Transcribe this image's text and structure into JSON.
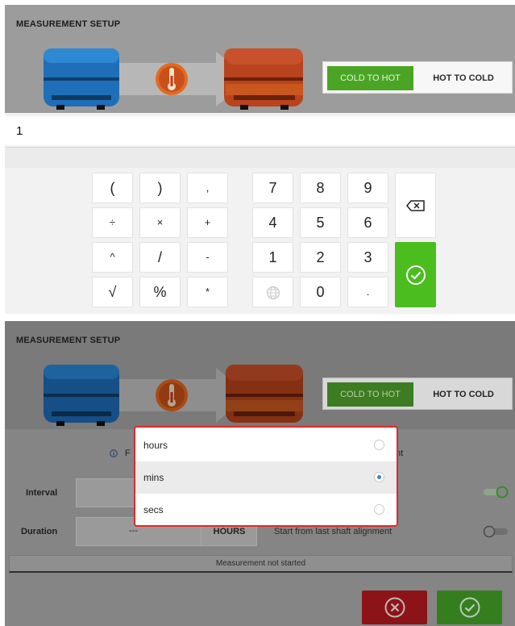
{
  "top": {
    "title": "MEASUREMENT SETUP",
    "direction": {
      "cold_to_hot": "COLD TO HOT",
      "hot_to_cold": "HOT TO COLD",
      "active": "cold_to_hot"
    },
    "input_value": "1",
    "keys": [
      "(",
      ")",
      ",",
      "7",
      "8",
      "9",
      "÷",
      "×",
      "+",
      "4",
      "5",
      "6",
      "^",
      "/",
      "-",
      "1",
      "2",
      "3",
      "√",
      "%",
      "*",
      "0",
      "."
    ]
  },
  "bottom": {
    "title": "MEASUREMENT SETUP",
    "direction": {
      "cold_to_hot": "COLD TO HOT",
      "hot_to_cold": "HOT TO COLD"
    },
    "behind": {
      "info_left": "F",
      "info_right": "nt",
      "interval_label": "Interval",
      "duration_label": "Duration",
      "duration_value": "---",
      "duration_unit": "HOURS",
      "start_from_last": "Start from last shaft alignment"
    },
    "status": "Measurement not started",
    "unit_options": [
      {
        "label": "hours",
        "selected": false
      },
      {
        "label": "mins",
        "selected": true
      },
      {
        "label": "secs",
        "selected": false
      }
    ]
  },
  "colors": {
    "cold_machine": "#1e6fb8",
    "hot_machine": "#b8431c",
    "accent_green": "#4bbd1f",
    "cancel_red": "#8c1419",
    "dropdown_border": "#e02a2a",
    "radio_selected": "#3f83c8"
  },
  "icons": {
    "thermometer": "thermometer-icon",
    "backspace": "backspace-icon",
    "confirm": "check-circle-icon",
    "cancel": "x-circle-icon",
    "globe": "globe-icon",
    "info": "info-icon"
  }
}
